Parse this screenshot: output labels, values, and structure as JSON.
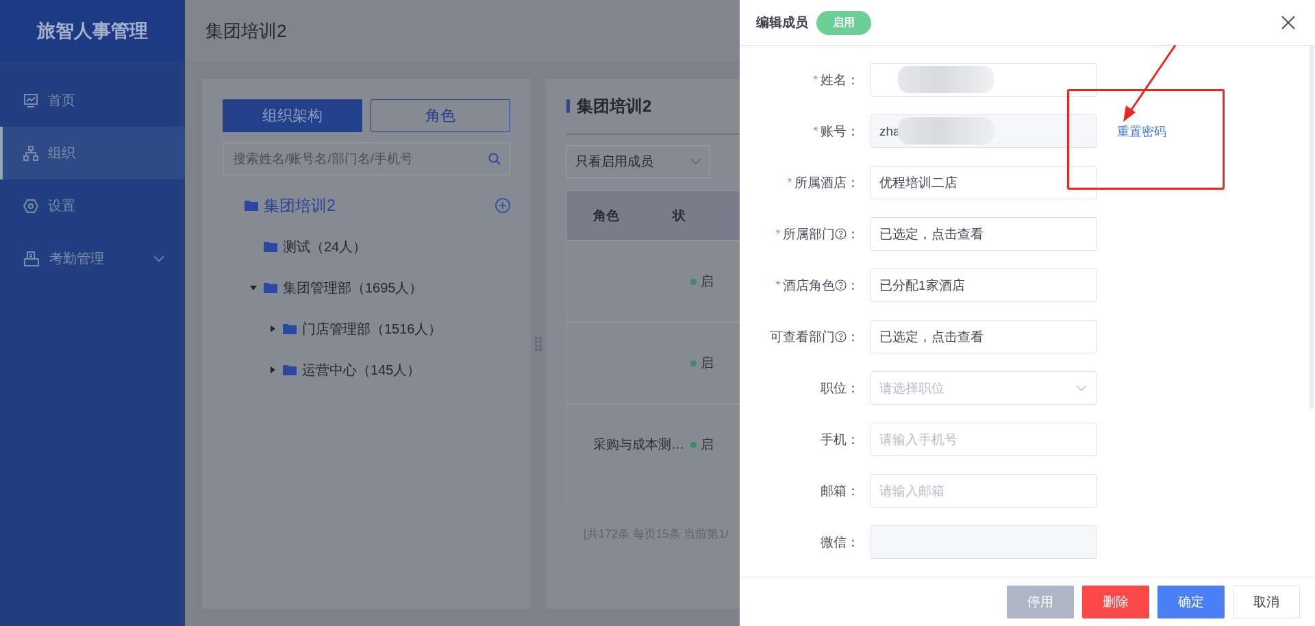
{
  "app": {
    "title": "旅智人事管理"
  },
  "sidebar": {
    "items": [
      {
        "label": "首页",
        "kind": "link",
        "selected": false
      },
      {
        "label": "组织",
        "kind": "link",
        "selected": true
      },
      {
        "label": "设置",
        "kind": "link",
        "selected": false
      },
      {
        "label": "考勤管理",
        "kind": "group",
        "selected": false,
        "expanded": false
      }
    ]
  },
  "page": {
    "title": "集团培训2"
  },
  "org_panel": {
    "tabs": [
      {
        "label": "组织架构",
        "selected": true
      },
      {
        "label": "角色",
        "selected": false
      }
    ],
    "search": {
      "placeholder": "搜索姓名/账号名/部门名/手机号"
    },
    "tree": [
      {
        "label": "集团培训2",
        "children": [
          {
            "label": "测试（24人）"
          },
          {
            "label": "集团管理部（1695人）",
            "expanded": true,
            "children": [
              {
                "label": "门店管理部（1516人）",
                "expanded": false
              },
              {
                "label": "运营中心（145人）",
                "expanded": false
              }
            ]
          }
        ]
      }
    ]
  },
  "member_panel": {
    "title": "集团培训2",
    "filter": "只看启用成员",
    "columns": [
      "角色",
      "状"
    ],
    "rows": [
      {
        "role": null,
        "status": "启",
        "color": "#3f8a63"
      },
      {
        "role": null,
        "status": "启",
        "color": "#3f8a63"
      },
      {
        "role": "采购与成本测…",
        "status": "启",
        "color": "#3f8a63"
      }
    ],
    "pagination": "[共172条 每页15条 当前第1/"
  },
  "drawer": {
    "title": "编辑成员",
    "status": "启用",
    "required_mark": "*",
    "colon": "：",
    "fields": [
      {
        "label": "姓名",
        "required": true,
        "help": false,
        "kind": "text",
        "redacted": true
      },
      {
        "label": "账号",
        "required": true,
        "help": false,
        "kind": "disabled",
        "value": "zha",
        "redacted": true,
        "action": "重置密码"
      },
      {
        "label": "所属酒店",
        "required": true,
        "help": false,
        "kind": "text",
        "value": "优程培训二店"
      },
      {
        "label": "所属部门",
        "required": true,
        "help": true,
        "kind": "text",
        "value": "已选定，点击查看"
      },
      {
        "label": "酒店角色",
        "required": true,
        "help": true,
        "kind": "text",
        "value": "已分配1家酒店"
      },
      {
        "label": "可查看部门",
        "required": false,
        "help": true,
        "kind": "text",
        "value": "已选定，点击查看"
      },
      {
        "label": "职位",
        "required": false,
        "help": false,
        "kind": "select",
        "placeholder": "请选择职位"
      },
      {
        "label": "手机",
        "required": false,
        "help": false,
        "kind": "text",
        "placeholder": "请输入手机号"
      },
      {
        "label": "邮箱",
        "required": false,
        "help": false,
        "kind": "text",
        "placeholder": "请输入邮箱"
      },
      {
        "label": "微信",
        "required": false,
        "help": false,
        "kind": "disabled"
      }
    ],
    "buttons": [
      {
        "label": "停用",
        "kind": "muted"
      },
      {
        "label": "删除",
        "kind": "danger"
      },
      {
        "label": "确定",
        "kind": "primary"
      },
      {
        "label": "取消",
        "kind": "plain"
      }
    ]
  }
}
